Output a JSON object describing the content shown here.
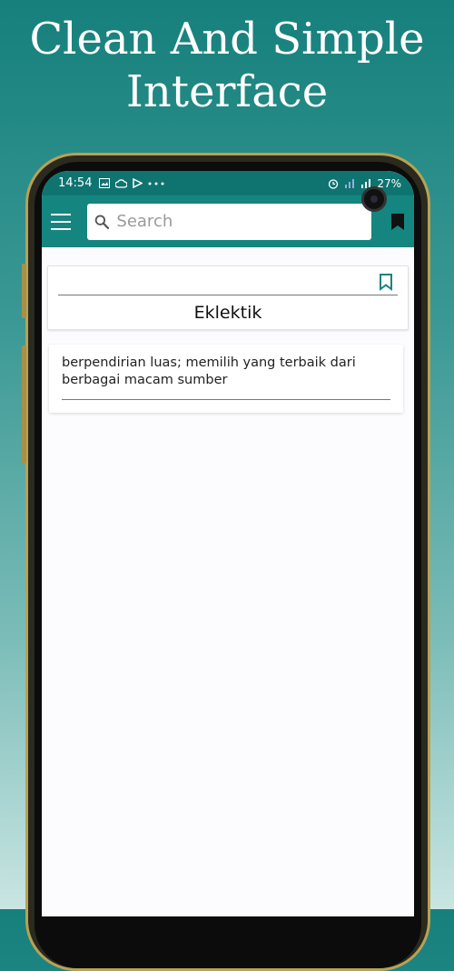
{
  "promo": {
    "title_line1": "Clean And Simple",
    "title_line2": "Interface"
  },
  "statusbar": {
    "time": "14:54",
    "battery": "27%",
    "left_icons": [
      "image-icon",
      "cloud-icon",
      "play-icon",
      "more-dots-icon"
    ],
    "right_icons": [
      "alarm-icon",
      "signal-icon",
      "signal-icon"
    ]
  },
  "toolbar": {
    "search_placeholder": "Search"
  },
  "entry": {
    "word": "Eklektik",
    "definition": "berpendirian luas; memilih yang terbaik dari berbagai macam sumber"
  },
  "colors": {
    "accent": "#158580",
    "statusbar": "#0f7470"
  }
}
